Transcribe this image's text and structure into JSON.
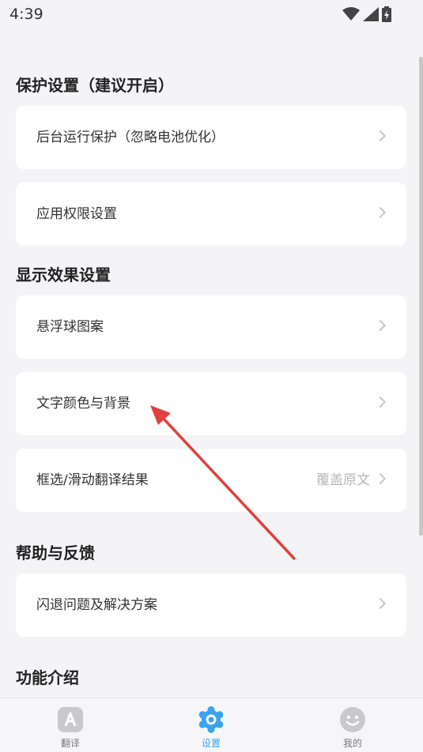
{
  "status": {
    "time": "4:39"
  },
  "sections": [
    {
      "title": "保护设置（建议开启）"
    },
    {
      "title": "显示效果设置"
    },
    {
      "title": "帮助与反馈"
    },
    {
      "title": "功能介绍"
    }
  ],
  "items": [
    {
      "label": "后台运行保护（忽略电池优化）",
      "value": ""
    },
    {
      "label": "应用权限设置",
      "value": ""
    },
    {
      "label": "悬浮球图案",
      "value": ""
    },
    {
      "label": "文字颜色与背景",
      "value": ""
    },
    {
      "label": "框选/滑动翻译结果",
      "value": "覆盖原文"
    },
    {
      "label": "闪退问题及解决方案",
      "value": ""
    }
  ],
  "tabs": [
    {
      "label": "翻译",
      "icon": "translate-icon"
    },
    {
      "label": "设置",
      "icon": "settings-gear-icon",
      "active": true
    },
    {
      "label": "我的",
      "icon": "smiley-face-icon"
    }
  ],
  "colors": {
    "accent": "#3aa3f0",
    "annotation_arrow": "#e04040",
    "background": "#f4f4f6"
  }
}
